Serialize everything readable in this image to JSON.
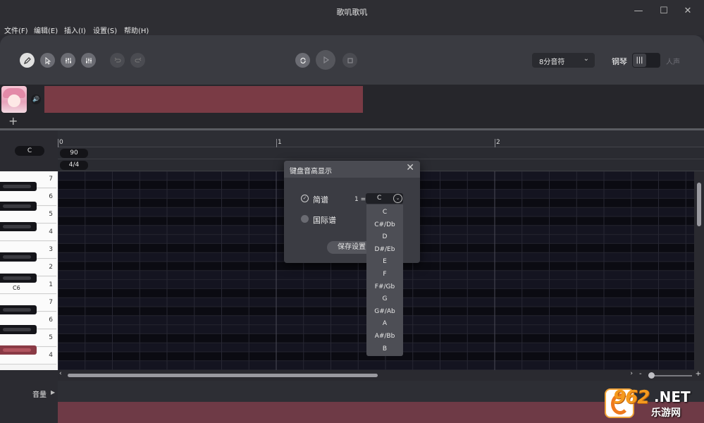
{
  "window": {
    "title": "歌叽歌叽",
    "min_icon": "minimize-icon",
    "max_icon": "maximize-icon",
    "close_icon": "close-icon"
  },
  "menu": [
    "文件(F)",
    "编辑(E)",
    "插入(I)",
    "设置(S)",
    "帮助(H)"
  ],
  "toolbar": {
    "tools": [
      "pencil-icon",
      "pointer-icon",
      "mixer-icon",
      "tuning-icon",
      "undo-icon",
      "redo-icon"
    ],
    "transport": [
      "loop-icon",
      "play-icon",
      "stop-icon"
    ],
    "note_length": "8分音符",
    "piano_label": "钢琴",
    "voice_label": "人声"
  },
  "track": {
    "add_label": "+"
  },
  "roll": {
    "key_label": "C",
    "tempo": "90",
    "time_signature": "4/4",
    "measures": [
      "0",
      "1",
      "2"
    ],
    "key_degrees": [
      "7",
      "6",
      "5",
      "4",
      "3",
      "2",
      "1",
      "7",
      "6",
      "5",
      "4"
    ],
    "octave_label": "C6"
  },
  "volume": {
    "label": "音量"
  },
  "zoom": {
    "minus": "-",
    "plus": "+"
  },
  "dialog": {
    "title": "键盘音高显示",
    "option_numbered": "简谱",
    "option_international": "国际谱",
    "key_prefix": "1 =",
    "key_value": "C",
    "save_label": "保存设置",
    "key_options": [
      "C",
      "C#/Db",
      "D",
      "D#/Eb",
      "E",
      "F",
      "F#/Gb",
      "G",
      "G#/Ab",
      "A",
      "A#/Bb",
      "B"
    ]
  },
  "watermark": {
    "logo": "962",
    "domain": ".NET",
    "sub": "乐游网"
  },
  "colors": {
    "accent_track": "#7a3b45",
    "volume_band": "#6e3a46",
    "grid_bg": "#0f0f17"
  }
}
